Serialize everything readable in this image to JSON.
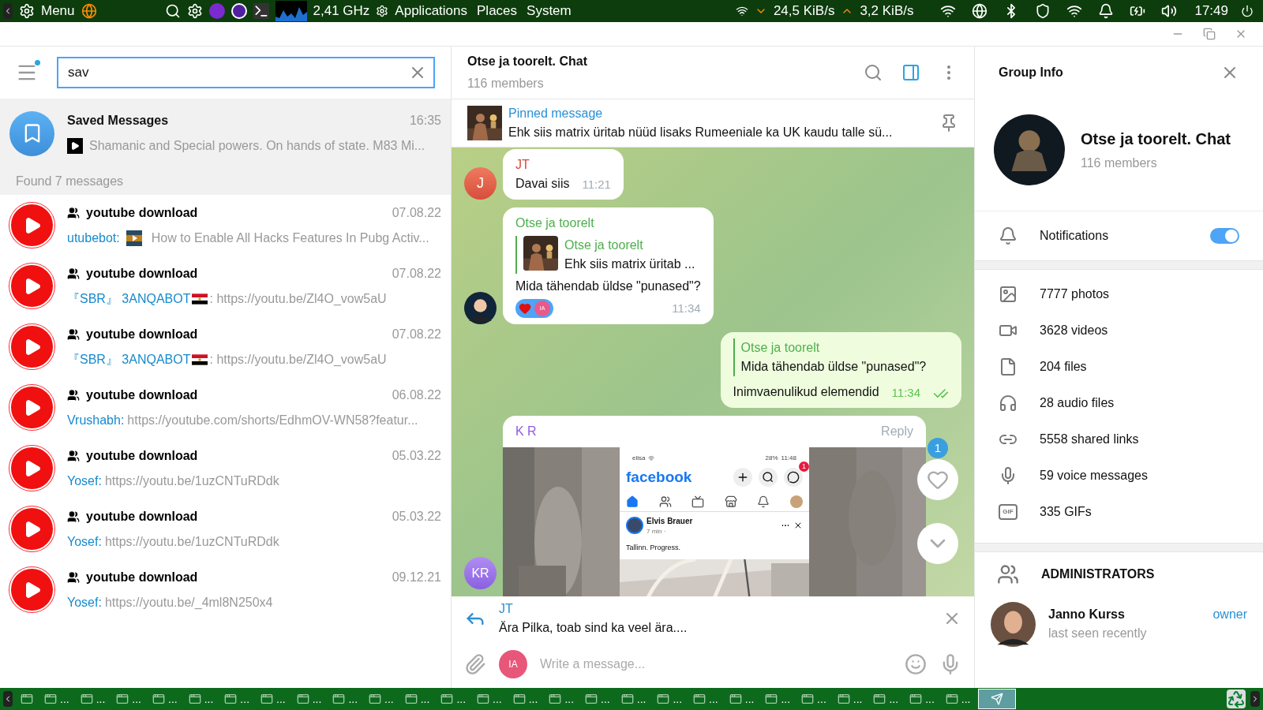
{
  "top_panel": {
    "menu": "Menu",
    "cpu": "2,41 GHz",
    "menus": [
      "Applications",
      "Places",
      "System"
    ],
    "download": "24,5 KiB/s",
    "upload": "3,2 KiB/s",
    "clock": "17:49"
  },
  "sidebar": {
    "search": {
      "value": "sav"
    },
    "saved": {
      "title": "Saved Messages",
      "time": "16:35",
      "preview": "Shamanic and Special powers. On hands of state.  M83 Mi..."
    },
    "found": "Found 7 messages",
    "results": [
      {
        "chat": "youtube download",
        "date": "07.08.22",
        "sender": "utubebot:",
        "kind": "video",
        "text": "How to Enable All Hacks Features In Pubg Activ..."
      },
      {
        "chat": "youtube download",
        "date": "07.08.22",
        "sender": "『SBR』 3ANQABOT",
        "kind": "flag",
        "text": ": https://youtu.be/Zl4O_vow5aU"
      },
      {
        "chat": "youtube download",
        "date": "07.08.22",
        "sender": "『SBR』 3ANQABOT",
        "kind": "flag",
        "text": ": https://youtu.be/Zl4O_vow5aU"
      },
      {
        "chat": "youtube download",
        "date": "06.08.22",
        "sender": "Vrushabh:",
        "text": "https://youtube.com/shorts/EdhmOV-WN58?featur..."
      },
      {
        "chat": "youtube download",
        "date": "05.03.22",
        "sender": "Yosef:",
        "text": "https://youtu.be/1uzCNTuRDdk"
      },
      {
        "chat": "youtube download",
        "date": "05.03.22",
        "sender": "Yosef:",
        "text": "https://youtu.be/1uzCNTuRDdk"
      },
      {
        "chat": "youtube download",
        "date": "09.12.21",
        "sender": "Yosef:",
        "text": "https://youtu.be/_4ml8N250x4"
      }
    ]
  },
  "chat": {
    "title": "Otse ja toorelt. Chat",
    "members": "116 members",
    "pinned": {
      "label": "Pinned message",
      "text": "Ehk siis matrix üritab nüüd lisaks Rumeeniale ka UK kaudu talle sü..."
    },
    "messages": [
      {
        "kind": "incoming",
        "sender": "JT",
        "avatar": "J",
        "text": "Davai siis",
        "time": "11:21"
      },
      {
        "kind": "incoming",
        "sender": "Otse ja toorelt",
        "reply": {
          "sender": "Otse ja toorelt",
          "text": "Ehk siis matrix üritab ..."
        },
        "text": "Mida tähendab üldse \"punased\"?",
        "reaction": "IA",
        "time": "11:34"
      },
      {
        "kind": "outgoing",
        "reply": {
          "sender": "Otse ja toorelt",
          "text": "Mida tähendab üldse \"punased\"?"
        },
        "text": "Inimvaenulikud elemendid",
        "time": "11:34",
        "read": true
      },
      {
        "sender": "K R",
        "reply_label": "Reply",
        "avatar": "KR",
        "screenshot": {
          "carrier": "elisa",
          "battery": "28%",
          "clock": "11:48",
          "brand": "facebook",
          "notif": "1",
          "poster": "Elvis Brauer",
          "age": "7 min ·",
          "post": "Tallinn. Progress."
        }
      }
    ],
    "unread": "1",
    "reply_bar": {
      "sender": "JT",
      "text": "Ära Pilka, toab sind ka veel ära...."
    },
    "composer": {
      "avatar": "IA",
      "placeholder": "Write a message..."
    }
  },
  "group_info": {
    "title": "Group Info",
    "name": "Otse ja toorelt. Chat",
    "members": "116 members",
    "notifications": {
      "label": "Notifications",
      "on": true
    },
    "media": [
      {
        "kind": "photos",
        "label": "7777 photos"
      },
      {
        "kind": "videos",
        "label": "3628 videos"
      },
      {
        "kind": "files",
        "label": "204 files"
      },
      {
        "kind": "audio",
        "label": "28 audio files"
      },
      {
        "kind": "links",
        "label": "5558 shared links"
      },
      {
        "kind": "voice",
        "label": "59 voice messages"
      },
      {
        "kind": "gifs",
        "label": "335 GIFs",
        "badge": "GIF"
      }
    ],
    "admins_title": "ADMINISTRATORS",
    "admins": [
      {
        "name": "Janno Kurss",
        "status": "last seen recently",
        "role": "owner"
      }
    ]
  },
  "taskbar": {
    "items": [
      {
        "selected": false
      },
      {
        "label": "...",
        "selected": false
      },
      {
        "label": "...",
        "selected": false
      },
      {
        "label": "...",
        "selected": false
      },
      {
        "label": "...",
        "selected": false
      },
      {
        "label": "...",
        "selected": false
      },
      {
        "label": "...",
        "selected": false
      },
      {
        "label": "...",
        "selected": false
      },
      {
        "label": "...",
        "selected": false
      },
      {
        "label": "...",
        "selected": false
      },
      {
        "label": "...",
        "selected": false
      },
      {
        "label": "...",
        "selected": false
      },
      {
        "label": "...",
        "selected": false
      },
      {
        "label": "...",
        "selected": false
      },
      {
        "label": "...",
        "selected": false
      },
      {
        "label": "...",
        "selected": false
      },
      {
        "label": "...",
        "selected": false
      },
      {
        "label": "...",
        "selected": false
      },
      {
        "label": "...",
        "selected": false
      },
      {
        "label": "...",
        "selected": false
      },
      {
        "label": "...",
        "selected": false
      },
      {
        "label": "...",
        "selected": false
      },
      {
        "label": "...",
        "selected": false
      },
      {
        "label": "...",
        "selected": false
      },
      {
        "label": "...",
        "selected": false
      },
      {
        "label": "...",
        "selected": false
      },
      {
        "label": "...",
        "selected": false
      },
      {
        "selected": true
      }
    ]
  }
}
